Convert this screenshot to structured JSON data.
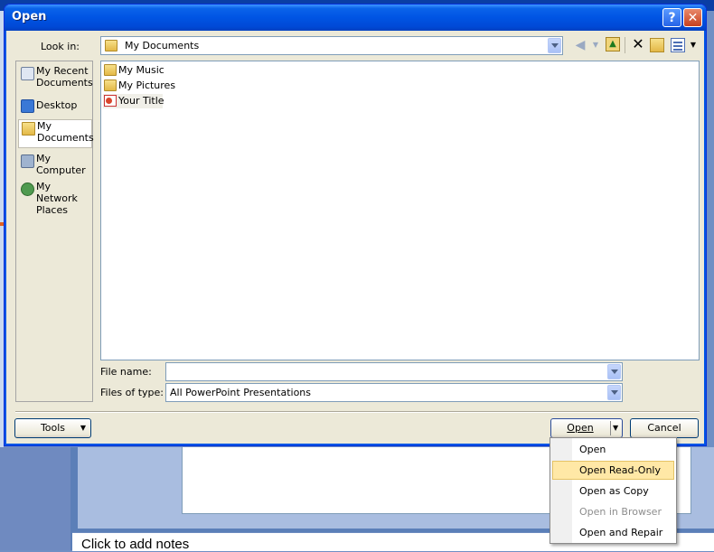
{
  "dialog": {
    "title": "Open",
    "help_button": "?",
    "close_button": "✕"
  },
  "look_in": {
    "label": "Look in:",
    "value": "My Documents"
  },
  "places": [
    {
      "label": "My Recent Documents",
      "icon": "recent-documents-icon"
    },
    {
      "label": "Desktop",
      "icon": "desktop-icon"
    },
    {
      "label": "My Documents",
      "icon": "my-documents-icon",
      "selected": true
    },
    {
      "label": "My Computer",
      "icon": "my-computer-icon"
    },
    {
      "label": "My Network Places",
      "icon": "network-places-icon"
    }
  ],
  "files": [
    {
      "name": "My Music",
      "icon": "folder-icon"
    },
    {
      "name": "My Pictures",
      "icon": "folder-icon"
    },
    {
      "name": "Your Title",
      "icon": "powerpoint-file-icon"
    }
  ],
  "file_name": {
    "label": "File name:",
    "value": ""
  },
  "files_of_type": {
    "label": "Files of type:",
    "value": "All PowerPoint Presentations"
  },
  "buttons": {
    "tools": "Tools",
    "open": "Open",
    "cancel": "Cancel"
  },
  "open_menu": [
    {
      "label": "Open",
      "enabled": true
    },
    {
      "label": "Open Read-Only",
      "enabled": true,
      "highlighted": true
    },
    {
      "label": "Open as Copy",
      "enabled": true
    },
    {
      "label": "Open in Browser",
      "enabled": false
    },
    {
      "label": "Open and Repair",
      "enabled": true
    }
  ],
  "background": {
    "notes_placeholder": "Click to add notes"
  },
  "colors": {
    "titlebar": "#0054e3",
    "dialog_face": "#ece9d8",
    "menu_highlight": "#ffe8a6"
  }
}
